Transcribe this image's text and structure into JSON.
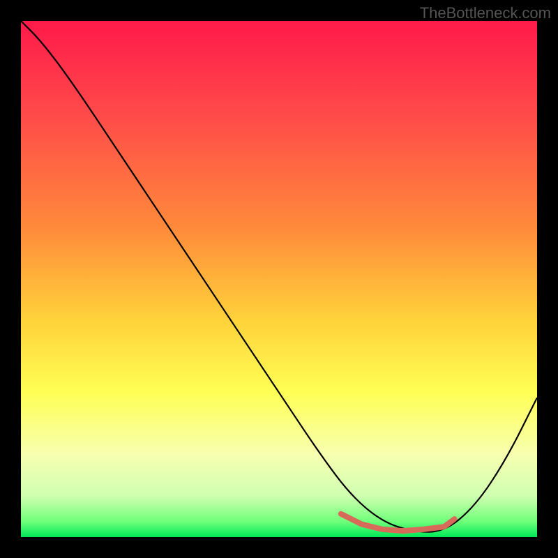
{
  "watermark": "TheBottleneck.com",
  "chart_data": {
    "type": "line",
    "title": "",
    "xlabel": "",
    "ylabel": "",
    "xlim": [
      0,
      100
    ],
    "ylim": [
      0,
      100
    ],
    "gradient_stops": [
      {
        "offset": 0,
        "color": "#ff1a4a"
      },
      {
        "offset": 18,
        "color": "#ff4a4a"
      },
      {
        "offset": 40,
        "color": "#ff8a3a"
      },
      {
        "offset": 58,
        "color": "#ffd23a"
      },
      {
        "offset": 72,
        "color": "#ffff55"
      },
      {
        "offset": 84,
        "color": "#f7ffb0"
      },
      {
        "offset": 92,
        "color": "#d0ffb0"
      },
      {
        "offset": 97,
        "color": "#6fff7a"
      },
      {
        "offset": 100,
        "color": "#00e858"
      }
    ],
    "series": [
      {
        "name": "bottleneck-curve",
        "color": "#000000",
        "x": [
          0,
          4,
          10,
          20,
          30,
          40,
          50,
          58,
          64,
          70,
          76,
          82,
          88,
          94,
          100
        ],
        "y": [
          100,
          96,
          88,
          73,
          58,
          43,
          28,
          16,
          8,
          3,
          1,
          1,
          6,
          15,
          27
        ]
      }
    ],
    "highlight_segment": {
      "name": "optimal-range",
      "color": "#d86a5a",
      "x": [
        62,
        66,
        70,
        74,
        78,
        82,
        84
      ],
      "y": [
        4.5,
        2.5,
        1.5,
        1.2,
        1.5,
        2.0,
        3.5
      ]
    }
  }
}
